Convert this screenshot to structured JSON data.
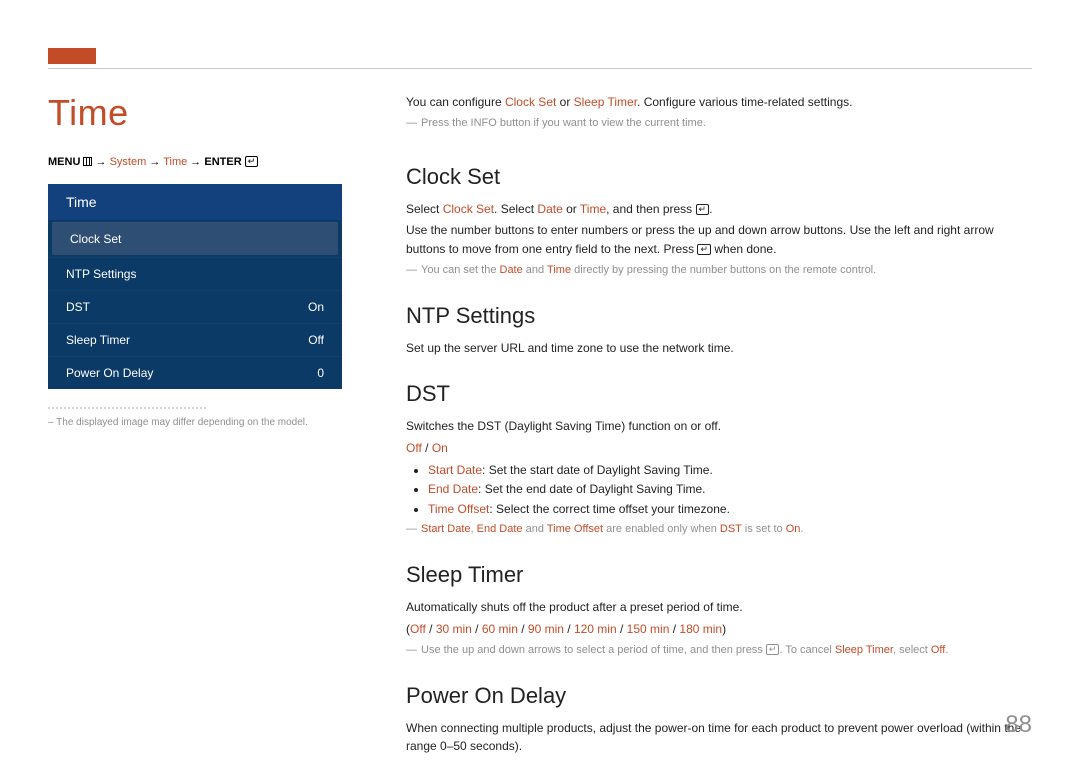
{
  "page_number": "88",
  "title": "Time",
  "breadcrumb": {
    "prefix": "MENU",
    "path": [
      "System",
      "Time"
    ],
    "suffix": "ENTER"
  },
  "menu_box": {
    "header": "Time",
    "items": [
      {
        "label": "Clock Set",
        "value": "",
        "selected": true
      },
      {
        "label": "NTP Settings"
      },
      {
        "label": "DST",
        "value": "On"
      },
      {
        "label": "Sleep Timer",
        "value": "Off"
      },
      {
        "label": "Power On Delay",
        "value": "0"
      }
    ]
  },
  "foot_note": "–  The displayed image may differ depending on the model.",
  "intro": {
    "line1_a": "You can configure ",
    "line1_b": "Clock Set",
    "line1_c": " or ",
    "line1_d": "Sleep Timer",
    "line1_e": ". Configure various time-related settings.",
    "note1": "Press the INFO button if you want to view the current time."
  },
  "clock_set": {
    "heading": "Clock Set",
    "p1_a": "Select ",
    "p1_b": "Clock Set",
    "p1_c": ". Select ",
    "p1_d": "Date",
    "p1_e": " or ",
    "p1_f": "Time",
    "p1_g": ", and then press ",
    "p1_h": ".",
    "p2": "Use the number buttons to enter numbers or press the up and down arrow buttons. Use the left and right arrow buttons to move from one entry field to the next. Press ",
    "p2b": " when done.",
    "note_a": "You can set the ",
    "note_b": "Date",
    "note_c": " and ",
    "note_d": "Time",
    "note_e": " directly by pressing the number buttons on the remote control."
  },
  "ntp": {
    "heading": "NTP Settings",
    "p1": "Set up the server URL and time zone to use the network time."
  },
  "dst": {
    "heading": "DST",
    "p1": "Switches the DST (Daylight Saving Time) function on or off.",
    "toggle_off": "Off",
    "toggle_sep": " / ",
    "toggle_on": "On",
    "bullets": [
      {
        "hl": "Start Date",
        "rest": ": Set the start date of Daylight Saving Time."
      },
      {
        "hl": "End Date",
        "rest": ": Set the end date of Daylight Saving Time."
      },
      {
        "hl": "Time Offset",
        "rest": ": Select the correct time offset your timezone."
      }
    ],
    "note_a": "Start Date",
    "note_b": ", ",
    "note_c": "End Date",
    "note_d": " and ",
    "note_e": "Time Offset",
    "note_f": " are enabled only when ",
    "note_g": "DST",
    "note_h": " is set to ",
    "note_i": "On",
    "note_j": "."
  },
  "sleep": {
    "heading": "Sleep Timer",
    "p1": "Automatically shuts off the product after a preset period of time.",
    "options": [
      "Off",
      "30 min",
      "60 min",
      "90 min",
      "120 min",
      "150 min",
      "180 min"
    ],
    "note_a": "Use the up and down arrows to select a period of time, and then press ",
    "note_b": ". To cancel ",
    "note_c": "Sleep Timer",
    "note_d": ", select ",
    "note_e": "Off",
    "note_f": "."
  },
  "power_delay": {
    "heading": "Power On Delay",
    "p1": "When connecting multiple products, adjust the power-on time for each product to prevent power overload (within the range 0–50 seconds)."
  }
}
